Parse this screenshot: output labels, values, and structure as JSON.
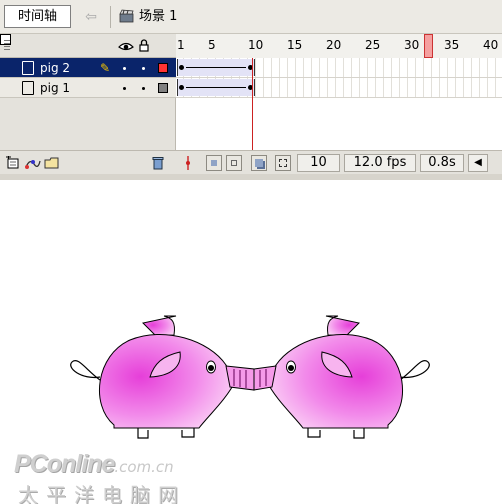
{
  "topbar": {
    "timeline_tab": "时间轴",
    "back_icon": "left-arrow-icon",
    "scene_icon": "clapperboard-icon",
    "scene_label": "场景 1"
  },
  "timeline": {
    "header_icons": [
      "eye-icon",
      "lock-icon",
      "outline-icon"
    ],
    "ruler_labels": [
      "1",
      "5",
      "10",
      "15",
      "20",
      "25",
      "30",
      "35",
      "40"
    ],
    "current_frame": "10",
    "frame_rate": "12.0 fps",
    "elapsed_time": "0.8s",
    "layers": [
      {
        "name": "pig 2",
        "selected": true,
        "outline_color": "#ff3333"
      },
      {
        "name": "pig 1",
        "selected": false,
        "outline_color": "#808080"
      }
    ],
    "tween_frames": [
      1,
      10
    ]
  },
  "watermark": {
    "brand": "PConline",
    "domain": ".com.cn",
    "chinese": "太平洋电脑网"
  },
  "colors": {
    "selection": "#0a246a",
    "playhead": "#cc2222",
    "pig_fill": "#f07ce6",
    "tween_fill": "#e3e3f6"
  }
}
